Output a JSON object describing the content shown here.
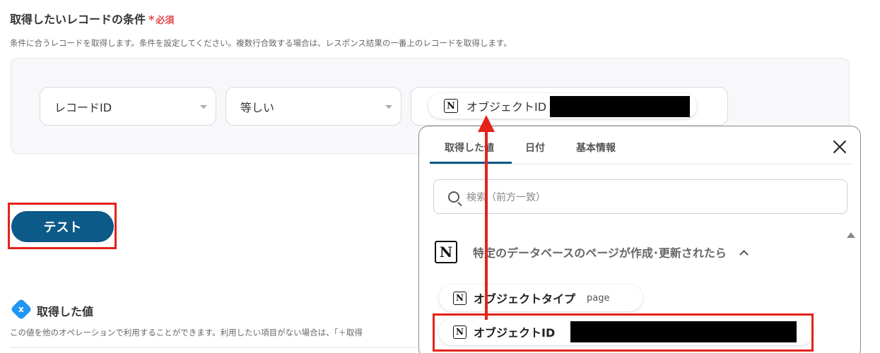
{
  "section": {
    "title": "取得したいレコードの条件",
    "required_star": "*",
    "required_label": "必須",
    "description": "条件に合うレコードを取得します。条件を設定してください。複数行合致する場合は、レスポンス結果の一番上のレコードを取得します。"
  },
  "condition": {
    "field_value": "レコードID",
    "operator_value": "等しい",
    "value_chip_label": "オブジェクトID"
  },
  "test_button": "テスト",
  "outputs": {
    "badge": "x",
    "title": "取得した値",
    "description": "この値を他のオペレーションで利用することができます。利用したい項目がない場合は、「＋取得"
  },
  "popover": {
    "tabs": [
      "取得した値",
      "日付",
      "基本情報"
    ],
    "active_tab": 0,
    "search_placeholder": "検索（前方一致）",
    "group_title": "特定のデータベースのページが作成･更新されたら",
    "items": [
      {
        "label": "オブジェクトタイプ",
        "value": "page"
      },
      {
        "label": "オブジェクトID",
        "value": ""
      }
    ]
  },
  "icons": {
    "notion_logo": "N",
    "close": "close-icon",
    "search": "search-icon"
  },
  "colors": {
    "accent": "#0b5a88",
    "required": "#e5484d",
    "highlight": "#e5221a",
    "badge": "#2196f3"
  }
}
